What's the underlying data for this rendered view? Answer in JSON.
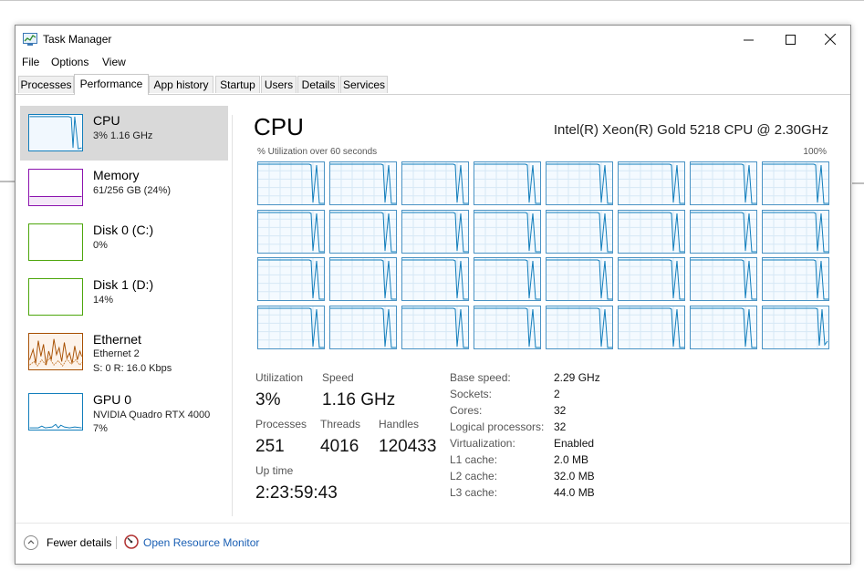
{
  "window": {
    "title": "Task Manager"
  },
  "menu": [
    "File",
    "Options",
    "View"
  ],
  "tabs": [
    "Processes",
    "Performance",
    "App history",
    "Startup",
    "Users",
    "Details",
    "Services"
  ],
  "active_tab": "Performance",
  "sidebar": [
    {
      "name": "CPU",
      "line1": "3%  1.16 GHz",
      "line2": "",
      "color": "#117dbb"
    },
    {
      "name": "Memory",
      "line1": "61/256 GB (24%)",
      "line2": "",
      "color": "#8b12ae"
    },
    {
      "name": "Disk 0 (C:)",
      "line1": "0%",
      "line2": "",
      "color": "#4da60c"
    },
    {
      "name": "Disk 1 (D:)",
      "line1": "14%",
      "line2": "",
      "color": "#4da60c"
    },
    {
      "name": "Ethernet",
      "line1": "Ethernet 2",
      "line2": "S: 0  R: 16.0 Kbps",
      "color": "#a74f01"
    },
    {
      "name": "GPU 0",
      "line1": "NVIDIA Quadro RTX 4000",
      "line2": "7%",
      "color": "#117dbb"
    }
  ],
  "main": {
    "title": "CPU",
    "model": "Intel(R) Xeon(R) Gold 5218 CPU @ 2.30GHz",
    "util_label": "% Utilization over 60 seconds",
    "util_max": "100%",
    "stats": {
      "utilization_label": "Utilization",
      "utilization": "3%",
      "speed_label": "Speed",
      "speed": "1.16 GHz",
      "processes_label": "Processes",
      "processes": "251",
      "threads_label": "Threads",
      "threads": "4016",
      "handles_label": "Handles",
      "handles": "120433",
      "uptime_label": "Up time",
      "uptime": "2:23:59:43"
    },
    "specs": [
      {
        "label": "Base speed:",
        "value": "2.29 GHz"
      },
      {
        "label": "Sockets:",
        "value": "2"
      },
      {
        "label": "Cores:",
        "value": "32"
      },
      {
        "label": "Logical processors:",
        "value": "32"
      },
      {
        "label": "Virtualization:",
        "value": "Enabled"
      },
      {
        "label": "L1 cache:",
        "value": "2.0 MB"
      },
      {
        "label": "L2 cache:",
        "value": "32.0 MB"
      },
      {
        "label": "L3 cache:",
        "value": "44.0 MB"
      }
    ]
  },
  "footer": {
    "fewer_details": "Fewer details",
    "open_monitor": "Open Resource Monitor"
  },
  "colors": {
    "cpu": "#117dbb",
    "link": "#1a5fb4"
  }
}
